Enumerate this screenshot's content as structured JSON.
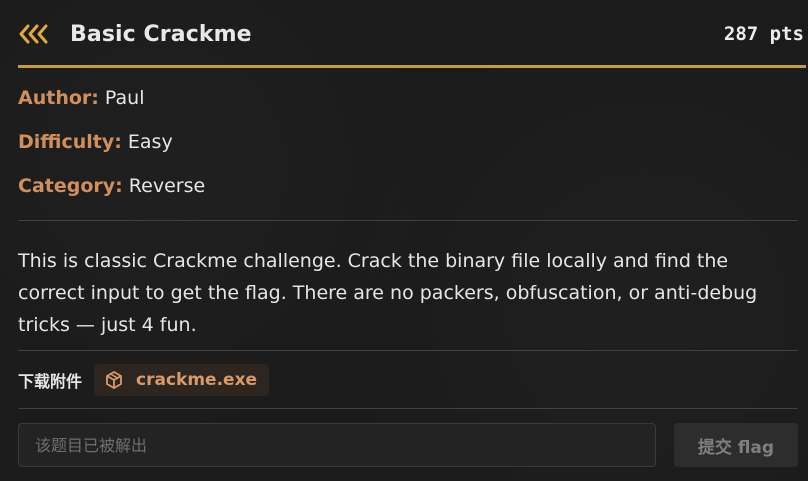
{
  "header": {
    "title": "Basic Crackme",
    "points": "287 pts",
    "back_icon": "triple-chevron-left-icon"
  },
  "meta": {
    "author_label": "Author:",
    "author_value": "Paul",
    "difficulty_label": "Difficulty:",
    "difficulty_value": "Easy",
    "category_label": "Category:",
    "category_value": "Reverse"
  },
  "description": "This is classic Crackme challenge. Crack the binary file locally and find the correct input to get the flag. There are no packers, obfuscation, or anti-debug tricks — just 4 fun.",
  "attachments": {
    "label": "下载附件",
    "file_name": "crackme.exe",
    "file_icon": "package-cube-icon"
  },
  "submit": {
    "placeholder": "该题目已被解出",
    "button_label": "提交 flag"
  },
  "colors": {
    "accent_gold": "#c89a45",
    "label_orange": "#d18f5d",
    "background": "#1b1b1b"
  }
}
